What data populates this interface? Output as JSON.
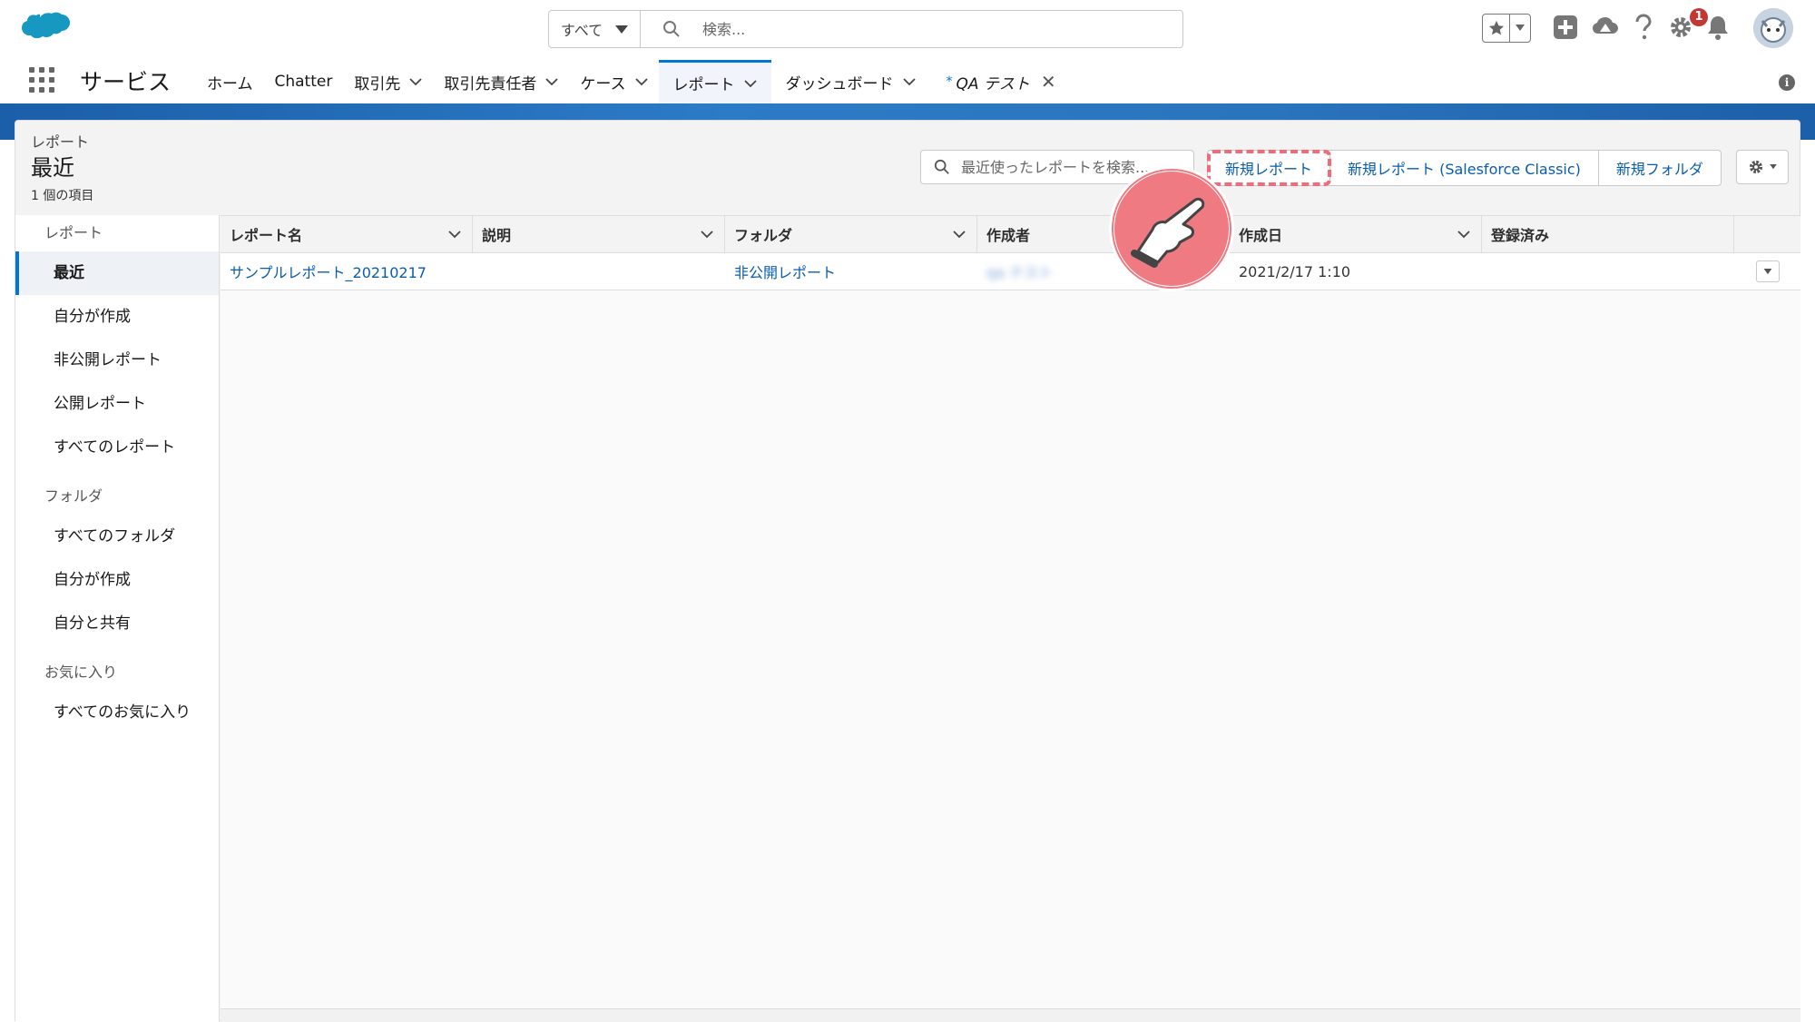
{
  "header": {
    "search_scope": "すべて",
    "search_placeholder": "検索...",
    "notification_count": "1"
  },
  "nav": {
    "app_name": "サービス",
    "tabs": [
      {
        "label": "ホーム"
      },
      {
        "label": "Chatter"
      },
      {
        "label": "取引先"
      },
      {
        "label": "取引先責任者"
      },
      {
        "label": "ケース"
      },
      {
        "label": "レポート"
      },
      {
        "label": "ダッシュボード"
      },
      {
        "label": "QA テスト",
        "modified_marker": "*"
      }
    ]
  },
  "page_header": {
    "eyebrow": "レポート",
    "title": "最近",
    "item_count": "1 個の項目",
    "search_placeholder": "最近使ったレポートを検索...",
    "buttons": {
      "new_report": "新規レポート",
      "new_report_classic": "新規レポート (Salesforce Classic)",
      "new_folder": "新規フォルダ"
    }
  },
  "sidebar": {
    "sections": [
      {
        "heading": "レポート",
        "items": [
          "最近",
          "自分が作成",
          "非公開レポート",
          "公開レポート",
          "すべてのレポート"
        ]
      },
      {
        "heading": "フォルダ",
        "items": [
          "すべてのフォルダ",
          "自分が作成",
          "自分と共有"
        ]
      },
      {
        "heading": "お気に入り",
        "items": [
          "すべてのお気に入り"
        ]
      }
    ]
  },
  "table": {
    "columns": [
      "レポート名",
      "説明",
      "フォルダ",
      "作成者",
      "作成日",
      "登録済み"
    ],
    "rows": [
      {
        "name": "サンプルレポート_20210217",
        "description": "",
        "folder": "非公開レポート",
        "created_by": "qa テスト",
        "created_date": "2021/2/17 1:10",
        "subscribed": ""
      }
    ]
  },
  "colors": {
    "brand_blue": "#0176d3",
    "link_blue": "#0b5cab",
    "highlight_pink": "#f26b7a",
    "badge_red": "#c23934"
  }
}
